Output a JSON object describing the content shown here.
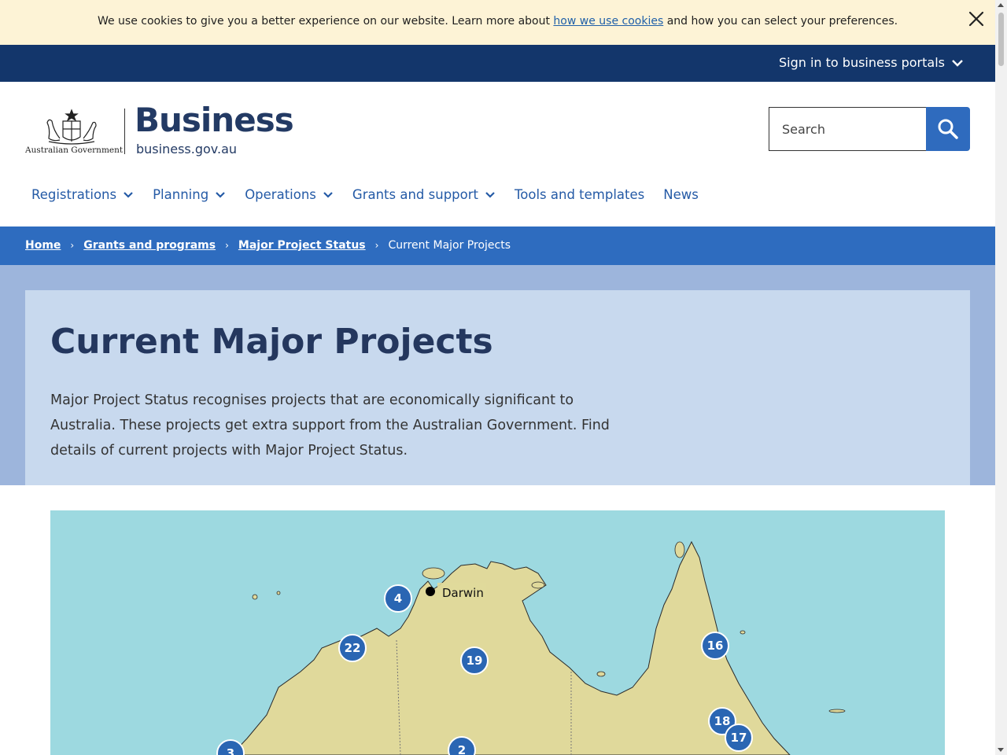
{
  "cookie": {
    "text_before": "We use cookies to give you a better experience on our website. Learn more about ",
    "link": "how we use cookies",
    "text_after": " and how you can select your preferences."
  },
  "topbar": {
    "portal_label": "Sign in to business portals"
  },
  "header": {
    "gov_label": "Australian Government",
    "brand": "Business",
    "url": "business.gov.au",
    "search_placeholder": "Search"
  },
  "nav": {
    "items": [
      {
        "label": "Registrations",
        "has_dropdown": true
      },
      {
        "label": "Planning",
        "has_dropdown": true
      },
      {
        "label": "Operations",
        "has_dropdown": true
      },
      {
        "label": "Grants and support",
        "has_dropdown": true
      },
      {
        "label": "Tools and templates",
        "has_dropdown": false
      },
      {
        "label": "News",
        "has_dropdown": false
      }
    ]
  },
  "breadcrumb": {
    "items": [
      "Home",
      "Grants and programs",
      "Major Project Status"
    ],
    "current": "Current Major Projects"
  },
  "hero": {
    "title": "Current Major Projects",
    "description": "Major Project Status recognises projects that are economically significant to Australia. These projects get extra support from the Australian Government. Find details of current projects with Major Project Status."
  },
  "map": {
    "city_label": "Darwin",
    "markers": [
      "4",
      "22",
      "19",
      "16",
      "18",
      "17",
      "2",
      "3"
    ]
  },
  "colors": {
    "navy": "#13366b",
    "accent_blue": "#2e6cbf",
    "brand_text": "#233a64",
    "sea": "#9dd9e0",
    "land": "#e0d99b",
    "marker": "#2a66b3"
  }
}
